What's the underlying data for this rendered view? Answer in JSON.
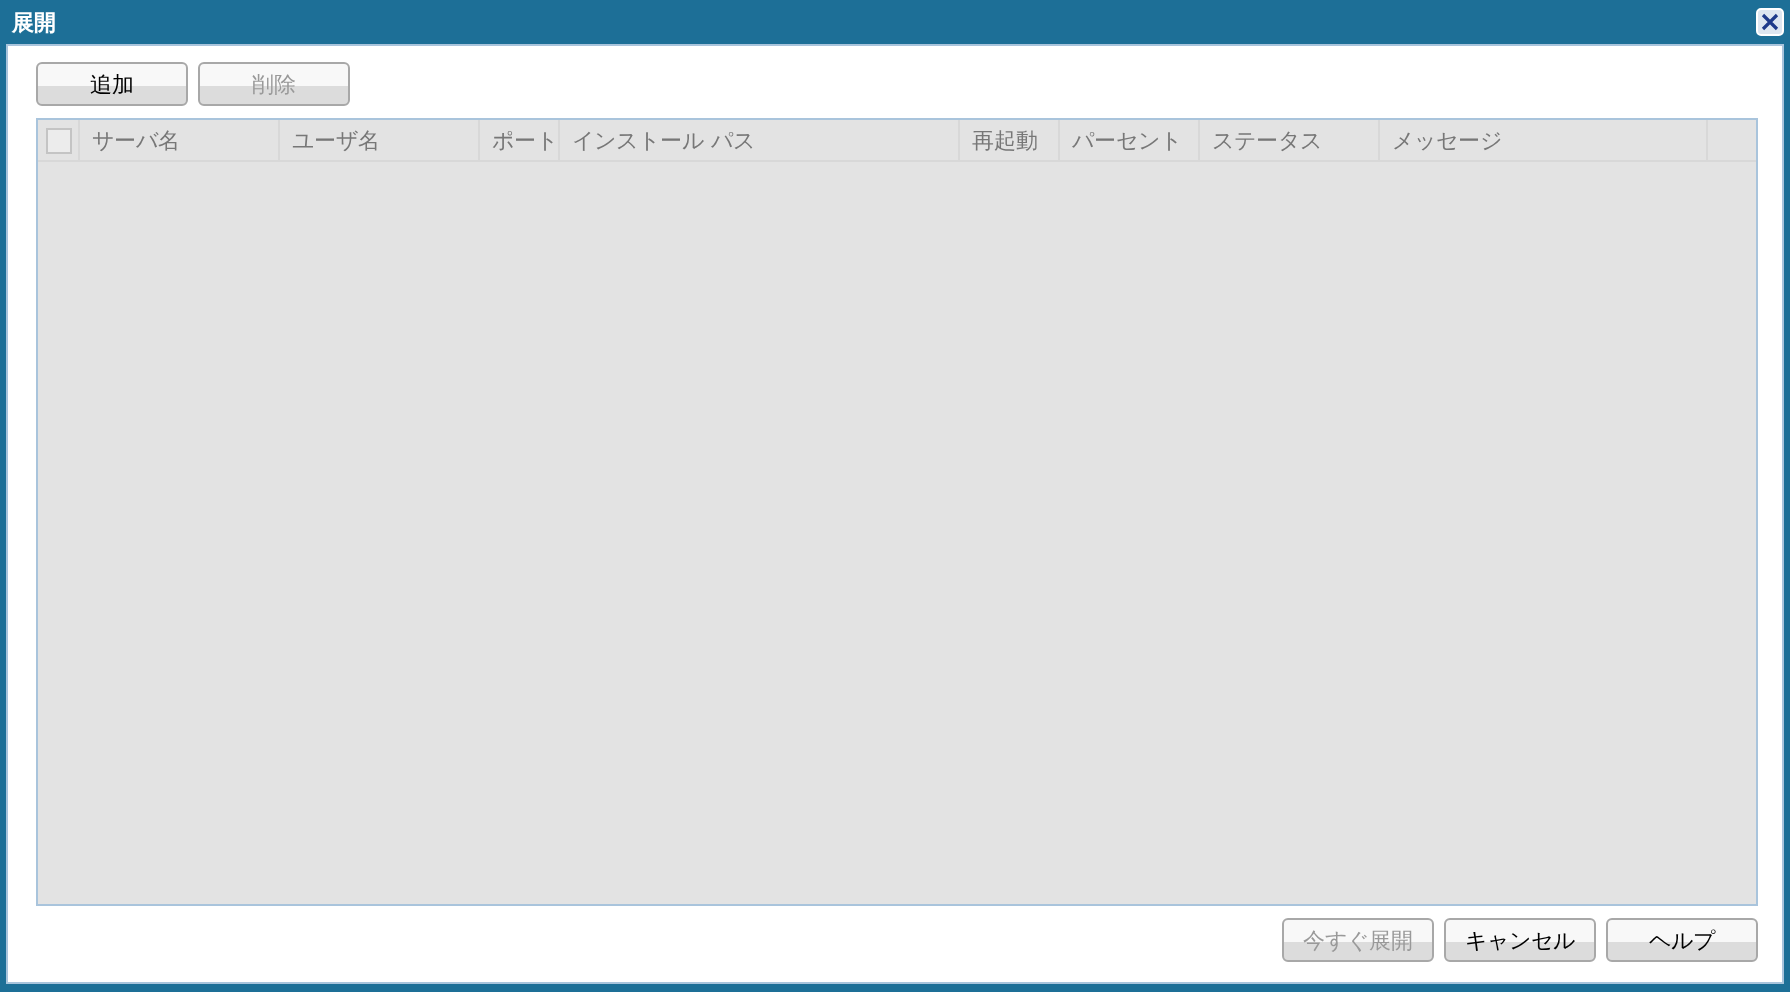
{
  "window": {
    "title": "展開"
  },
  "toolbar": [
    {
      "label": "追加",
      "disabled": false
    },
    {
      "label": "削除",
      "disabled": true
    }
  ],
  "table": {
    "select_all": {
      "checked": false,
      "disabled": true
    },
    "columns": [
      {
        "label": "サーバ名"
      },
      {
        "label": "ユーザ名"
      },
      {
        "label": "ポート"
      },
      {
        "label": "インストール パス"
      },
      {
        "label": "再起動"
      },
      {
        "label": "パーセント"
      },
      {
        "label": "ステータス"
      },
      {
        "label": "メッセージ"
      }
    ],
    "disabled": true
  },
  "buttons": [
    {
      "label": "今すぐ展開",
      "disabled": true
    },
    {
      "label": "キャンセル",
      "disabled": false
    },
    {
      "label": "ヘルプ",
      "disabled": false
    }
  ]
}
